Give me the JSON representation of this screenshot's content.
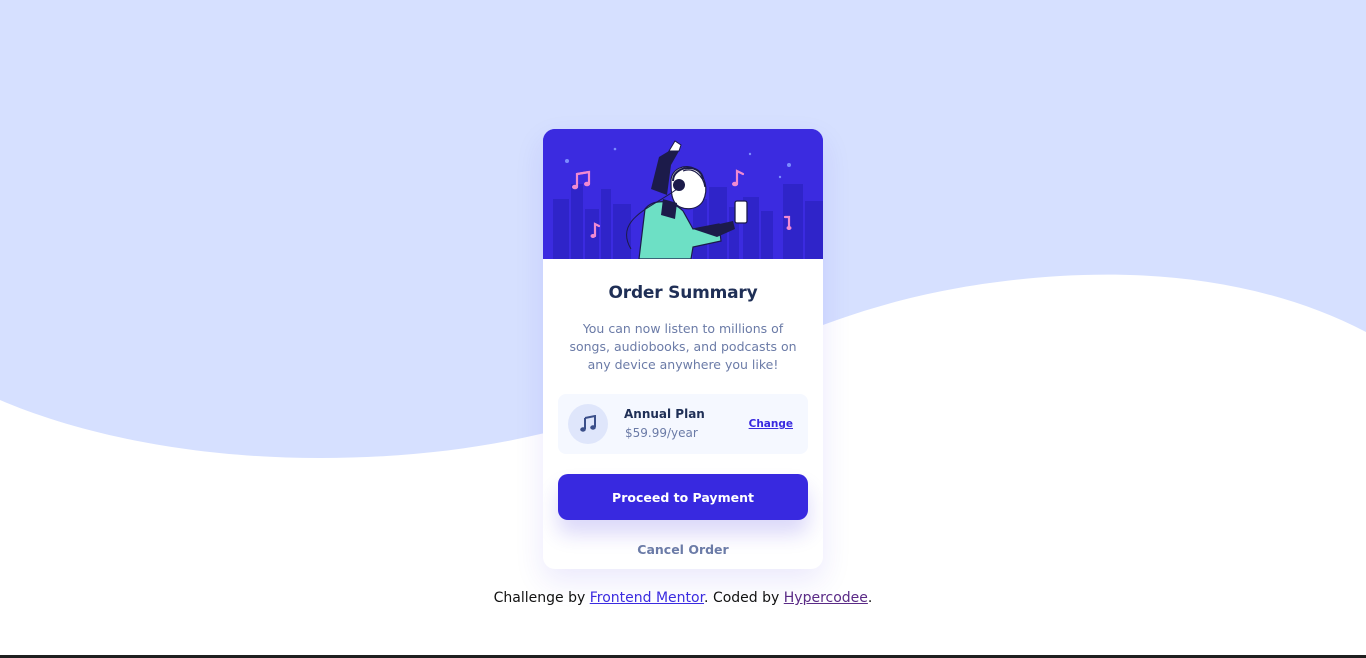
{
  "colors": {
    "background_pale_blue": "#d6e0ff",
    "primary": "#3829e0",
    "title_dark": "#1f2f56",
    "desc_gray": "#6b7ba7",
    "plan_bg": "#f5f8ff",
    "hero_teal": "#6de0c5",
    "hero_pink": "#f08ad1"
  },
  "hero": {
    "image_name": "hero-illustration"
  },
  "card": {
    "title": "Order Summary",
    "description": "You can now listen to millions of songs, audiobooks, and podcasts on any device anywhere you like!",
    "plan": {
      "icon": "music-note-icon",
      "name": "Annual Plan",
      "price": "$59.99/year",
      "change_label": "Change"
    },
    "primary_button": "Proceed to Payment",
    "cancel_button": "Cancel Order"
  },
  "footer": {
    "prefix": "Challenge by ",
    "link1": "Frontend Mentor",
    "middle": ". Coded by ",
    "link2": "Hypercodee",
    "suffix": "."
  }
}
